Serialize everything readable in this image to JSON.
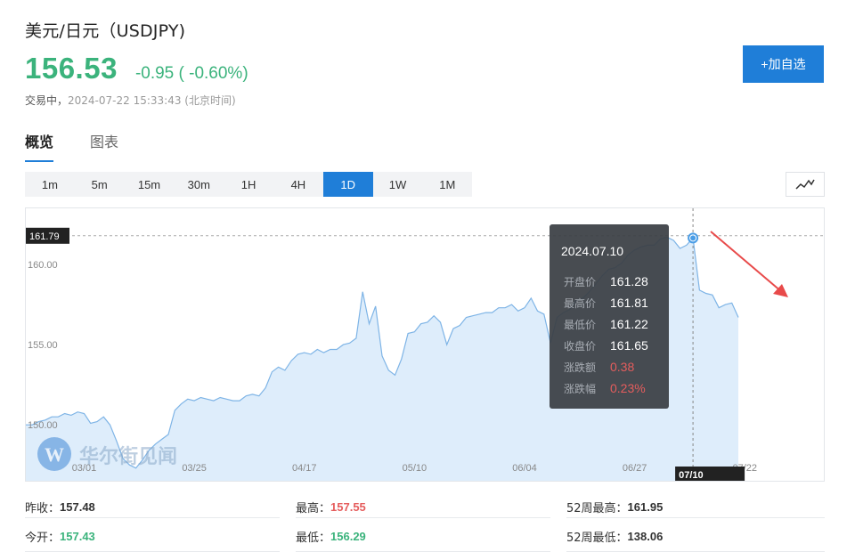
{
  "header": {
    "title": "美元/日元（USDJPY)",
    "price": "156.53",
    "change": "-0.95 ( -0.60%)",
    "status": "交易中，",
    "timestamp": "2024-07-22 15:33:43 (北京时间)",
    "add_watchlist": "+加自选"
  },
  "tabs": [
    {
      "label": "概览",
      "active": true
    },
    {
      "label": "图表",
      "active": false
    }
  ],
  "intervals": [
    {
      "label": "1m",
      "active": false
    },
    {
      "label": "5m",
      "active": false
    },
    {
      "label": "15m",
      "active": false
    },
    {
      "label": "30m",
      "active": false
    },
    {
      "label": "1H",
      "active": false
    },
    {
      "label": "4H",
      "active": false
    },
    {
      "label": "1D",
      "active": true
    },
    {
      "label": "1W",
      "active": false
    },
    {
      "label": "1M",
      "active": false
    }
  ],
  "chart_type_icon": "line-chart-icon",
  "watermark": "华尔街见闻",
  "chart_data": {
    "type": "area",
    "y_ticks": [
      "160.00",
      "155.00",
      "150.00"
    ],
    "y_tick_values": [
      160,
      155,
      150
    ],
    "x_ticks": [
      "03/01",
      "03/25",
      "04/17",
      "05/10",
      "06/04",
      "06/27",
      "07/22"
    ],
    "x_tick_index": [
      9,
      26,
      43,
      60,
      77,
      94,
      111
    ],
    "ylim": [
      146.4,
      163.5
    ],
    "max_label": "161.79",
    "max_value": 161.79,
    "crosshair_label": "07/10",
    "crosshair_index": 103,
    "values": [
      150.0,
      150.0,
      150.2,
      150.3,
      150.5,
      150.5,
      150.7,
      150.6,
      150.8,
      150.7,
      150.1,
      150.2,
      150.5,
      150.0,
      149.0,
      147.9,
      147.5,
      147.3,
      147.8,
      148.4,
      148.8,
      149.1,
      149.4,
      150.9,
      151.3,
      151.6,
      151.5,
      151.7,
      151.6,
      151.5,
      151.7,
      151.6,
      151.5,
      151.5,
      151.8,
      151.9,
      151.8,
      152.3,
      153.3,
      153.6,
      153.4,
      154.0,
      154.4,
      154.5,
      154.4,
      154.7,
      154.5,
      154.7,
      154.7,
      155.0,
      155.1,
      155.4,
      158.3,
      156.3,
      157.4,
      154.3,
      153.4,
      153.1,
      154.1,
      155.7,
      155.8,
      156.3,
      156.4,
      156.8,
      156.4,
      155.0,
      156.0,
      156.2,
      156.7,
      156.8,
      156.9,
      157.0,
      157.0,
      157.3,
      157.3,
      157.5,
      157.1,
      157.3,
      157.9,
      157.1,
      156.9,
      155.1,
      156.7,
      157.0,
      157.2,
      157.8,
      157.9,
      158.3,
      158.8,
      159.3,
      159.7,
      159.8,
      160.1,
      160.6,
      160.9,
      161.1,
      161.2,
      161.2,
      161.6,
      161.7,
      161.5,
      161.0,
      161.2,
      161.65,
      158.4,
      158.2,
      158.1,
      157.3,
      157.5,
      157.6,
      156.7
    ]
  },
  "tooltip": {
    "date": "2024.07.10",
    "rows": [
      {
        "key": "开盘价",
        "value": "161.28",
        "color": "#ffffff"
      },
      {
        "key": "最高价",
        "value": "161.81",
        "color": "#ffffff"
      },
      {
        "key": "最低价",
        "value": "161.22",
        "color": "#ffffff"
      },
      {
        "key": "收盘价",
        "value": "161.65",
        "color": "#ffffff"
      },
      {
        "key": "涨跌额",
        "value": "0.38",
        "color": "#e55d5d"
      },
      {
        "key": "涨跌幅",
        "value": "0.23%",
        "color": "#e55d5d"
      }
    ]
  },
  "stats": [
    [
      {
        "key": "昨收：",
        "value": "157.48",
        "color": "#222222"
      },
      {
        "key": "最高：",
        "value": "157.55",
        "color": "#e55d5d"
      },
      {
        "key": "52周最高：",
        "value": "161.95",
        "color": "#222222"
      }
    ],
    [
      {
        "key": "今开：",
        "value": "157.43",
        "color": "#3bb37c"
      },
      {
        "key": "最低：",
        "value": "156.29",
        "color": "#3bb37c"
      },
      {
        "key": "52周最低：",
        "value": "138.06",
        "color": "#222222"
      }
    ]
  ],
  "colors": {
    "accent": "#1f7ed8",
    "down_green": "#3bb37c",
    "up_red": "#e55d5d",
    "area_fill": "#deedfb",
    "area_line": "#7eb4e6"
  }
}
